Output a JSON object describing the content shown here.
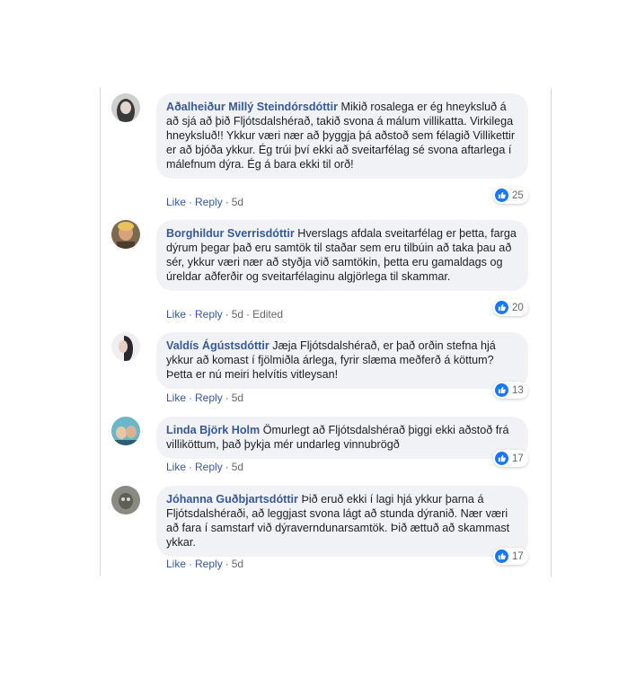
{
  "actions": {
    "like": "Like",
    "reply": "Reply",
    "edited": "Edited"
  },
  "comments": [
    {
      "author": "Aðalheiður Millý Steindórsdóttir",
      "text": "Mikið rosalega er ég hneyksluð á að sjá að þið Fljótsdalshérað, takið svona á málum villikatta. Virkilega hneyksluð!! Ykkur væri nær að þyggja þá aðstoð sem félagið Villikettir er að bjóða ykkur. Ég trúi því ekki að sveitarfélag sé svona aftarlega í málefnum dýra. Ég á bara ekki til orð!",
      "time": "5d",
      "likes": "25",
      "edited": false
    },
    {
      "author": "Borghildur Sverrisdóttir",
      "text": "Hverslags afdala sveitarfélag er þetta, farga dýrum þegar það eru samtök til staðar sem eru tilbúin að taka þau að sér, ykkur væri nær að styðja við samtökin, þetta eru gamaldags og úreldar aðferðir og sveitarfélaginu algjörlega til skammar.",
      "time": "5d",
      "likes": "20",
      "edited": true
    },
    {
      "author": "Valdís Ágústsdóttir",
      "text": "Jæja Fljótsdalshérað, er það orðin stefna hjá ykkur að komast í fjölmiðla árlega, fyrir slæma meðferð á köttum? Þetta er nú meiri helvítis vitleysan!",
      "time": "5d",
      "likes": "13",
      "edited": false
    },
    {
      "author": "Linda Björk Holm",
      "text": "Ömurlegt að Fljótsdalshérað þiggi ekki aðstoð frá villiköttum, það þykja mér undarleg vinnubrögð",
      "time": "5d",
      "likes": "17",
      "edited": false
    },
    {
      "author": "Jóhanna Guðbjartsdóttir",
      "text": "Þið eruð ekki í lagi hjá ykkur þarna á Fljótsdalshéraði, að leggjast svona lágt að stunda dýranið. Nær væri að fara í samstarf við dýraverndunarsamtök. Þið ættuð að skammast ykkar.",
      "time": "5d",
      "likes": "17",
      "edited": false
    }
  ]
}
